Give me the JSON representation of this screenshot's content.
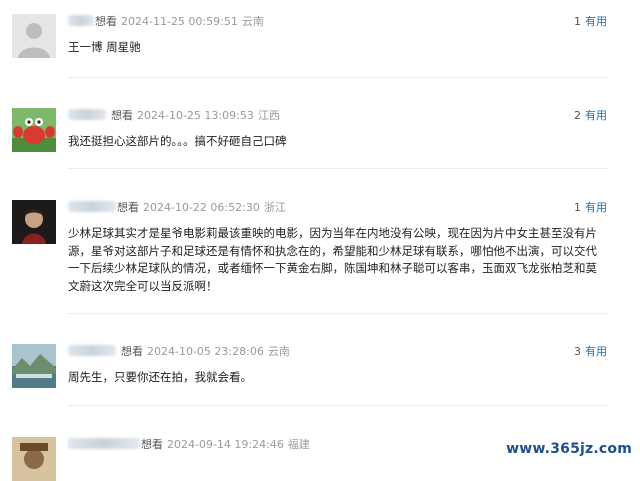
{
  "comments": [
    {
      "status": "想看",
      "time": "2024-11-25 00:59:51",
      "region": "云南",
      "useful_count": "1",
      "useful_label": "有用",
      "text": "王一博 周星驰"
    },
    {
      "status": "想看",
      "time": "2024-10-25 13:09:53",
      "region": "江西",
      "useful_count": "2",
      "useful_label": "有用",
      "text": "我还挺担心这部片的。。。搞不好砸自己口碑"
    },
    {
      "status": "想看",
      "time": "2024-10-22 06:52:30",
      "region": "浙江",
      "useful_count": "1",
      "useful_label": "有用",
      "text": "少林足球其实才是星爷电影莉最该重映的电影，因为当年在内地没有公映，现在因为片中女主甚至没有片源，星爷对这部片子和足球还是有情怀和执念在的，希望能和少林足球有联系，哪怕他不出演，可以交代一下后续少林足球队的情况，或者缅怀一下黄金右脚，陈国坤和林子聪可以客串，玉面双飞龙张柏芝和莫文蔚这次完全可以当反派啊！"
    },
    {
      "status": "想看",
      "time": "2024-10-05 23:28:06",
      "region": "云南",
      "useful_count": "3",
      "useful_label": "有用",
      "text": "周先生，只要你还在拍，我就会看。"
    },
    {
      "status": "想看",
      "time": "2024-09-14 19:24:46",
      "region": "福建",
      "useful_count": "",
      "useful_label": "",
      "text": ""
    }
  ],
  "watermark": "www.365jz.com"
}
